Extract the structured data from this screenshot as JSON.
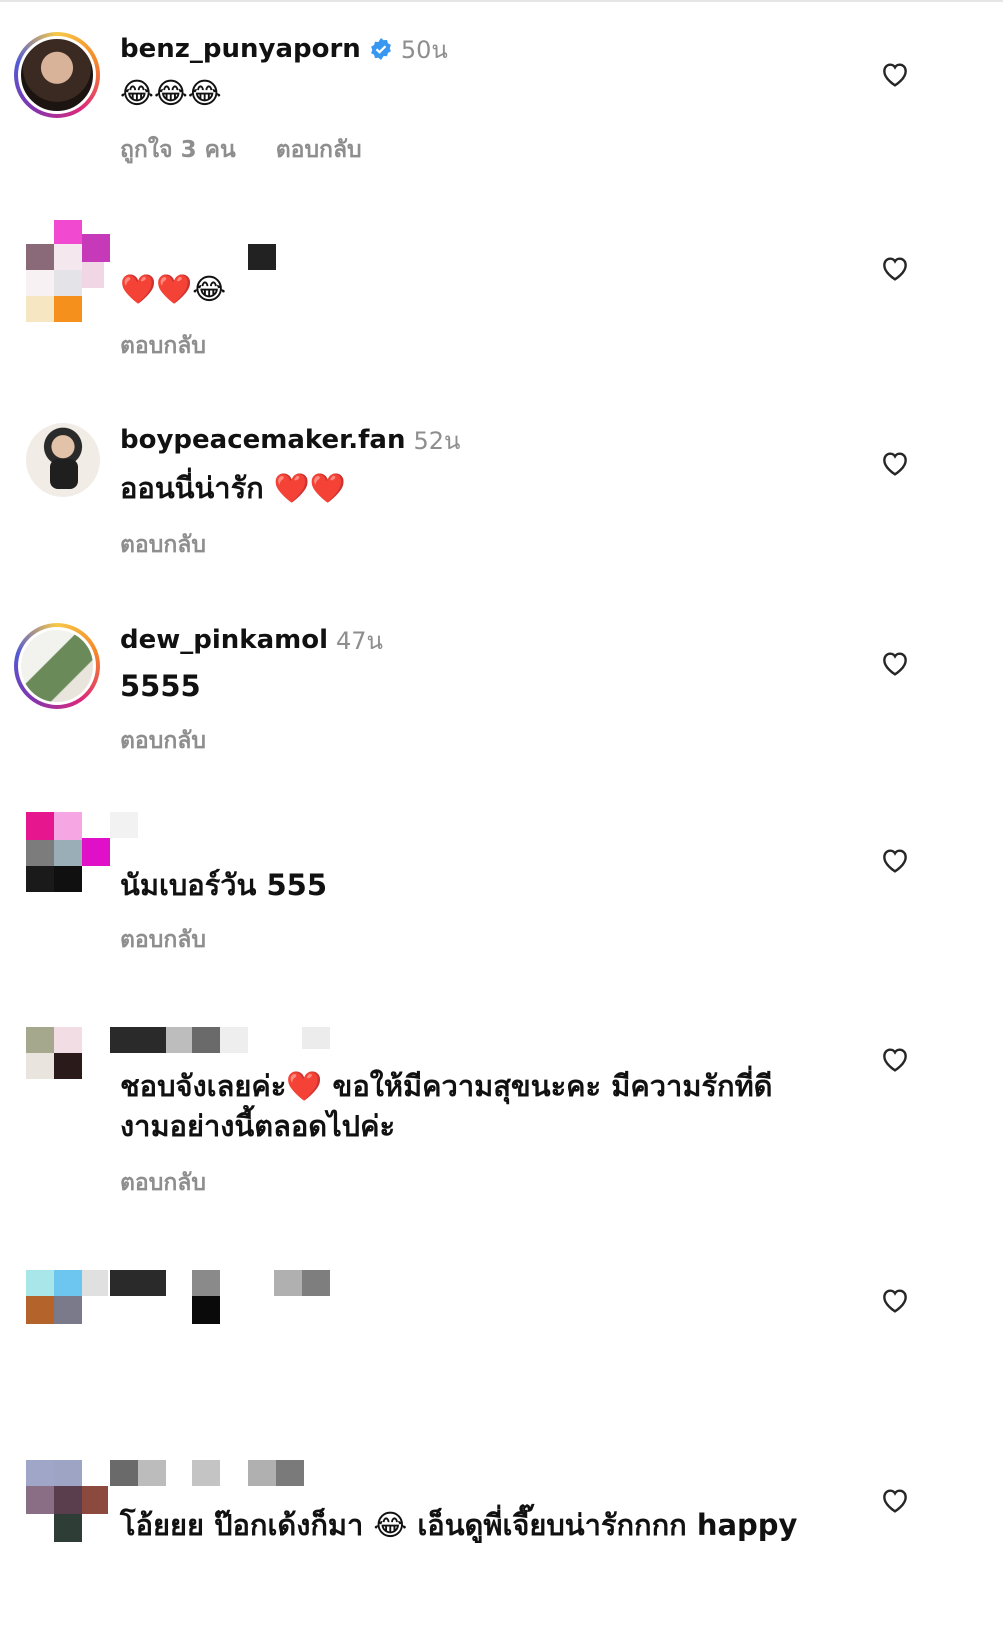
{
  "comments": [
    {
      "username": "benz_punyaporn",
      "time": "50น",
      "verified": true,
      "emoji_text": "😂😂😂",
      "likes_label": "ถูกใจ 3 คน",
      "reply_label": "ตอบกลับ"
    },
    {
      "username": "",
      "time": "",
      "emoji_text": "❤️❤️😂",
      "reply_label": "ตอบกลับ"
    },
    {
      "username": "boypeacemaker.fan",
      "time": "52น",
      "text": "ออนนี่น่ารัก ❤️❤️",
      "reply_label": "ตอบกลับ"
    },
    {
      "username": "dew_pinkamol",
      "time": "47น",
      "text": "5555",
      "reply_label": "ตอบกลับ"
    },
    {
      "username": "",
      "text": "นัมเบอร์วัน 555",
      "reply_label": "ตอบกลับ"
    },
    {
      "username": "",
      "text_line1": "ชอบจังเลยค่ะ❤️ ขอให้มีความสุขนะคะ มีความรักที่ดี",
      "text_line2": "งามอย่างนี้ตลอดไปค่ะ",
      "reply_label": "ตอบกลับ"
    },
    {
      "username": ""
    },
    {
      "username": "",
      "text": "โอ้ยยย ป๊อกเด้งก็มา 😂 เอ็นดูพี่เจี๊ยบน่ารักกกก happy"
    }
  ],
  "icons": {
    "heart": "heart-outline-icon",
    "verified": "verified-badge-icon"
  },
  "colors": {
    "verified_blue": "#3897f0",
    "muted_text": "#8e8e8e",
    "text": "#111111",
    "heart_red": "#e0141e"
  }
}
